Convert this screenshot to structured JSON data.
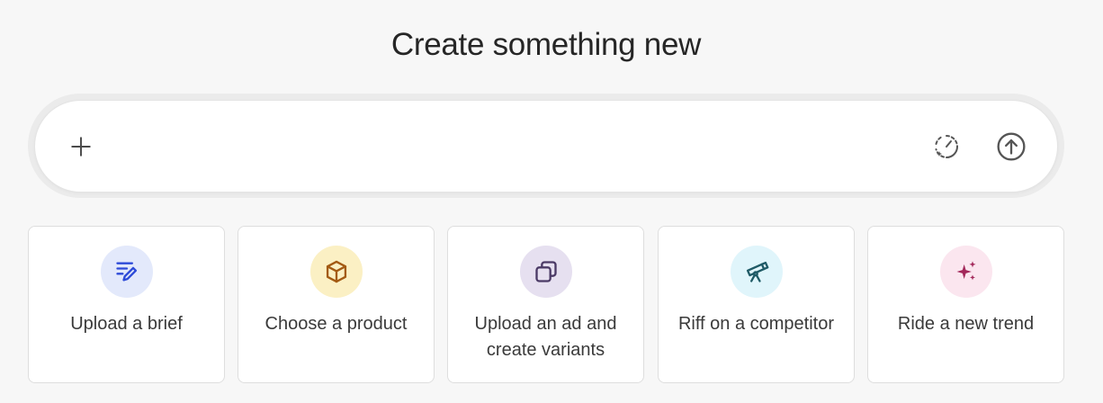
{
  "heading": "Create something new",
  "composer": {
    "placeholder": "",
    "add_icon": "plus-icon",
    "style_icon": "dashed-circle-sparkle-icon",
    "send_icon": "arrow-up-circle-icon"
  },
  "cards": [
    {
      "label": "Upload a brief",
      "icon": "pencil-lines-icon",
      "badge_color": "#e3e9fb",
      "icon_color": "#2d4ad8"
    },
    {
      "label": "Choose a product",
      "icon": "box-icon",
      "badge_color": "#fbf0c4",
      "icon_color": "#a35a12"
    },
    {
      "label": "Upload an ad and create variants",
      "icon": "copy-icon",
      "badge_color": "#e6e0f0",
      "icon_color": "#4b3a66"
    },
    {
      "label": "Riff on a competitor",
      "icon": "telescope-icon",
      "badge_color": "#e0f5fb",
      "icon_color": "#1f5a66"
    },
    {
      "label": "Ride a new trend",
      "icon": "sparkles-icon",
      "badge_color": "#fbe6ef",
      "icon_color": "#a3285a"
    }
  ]
}
